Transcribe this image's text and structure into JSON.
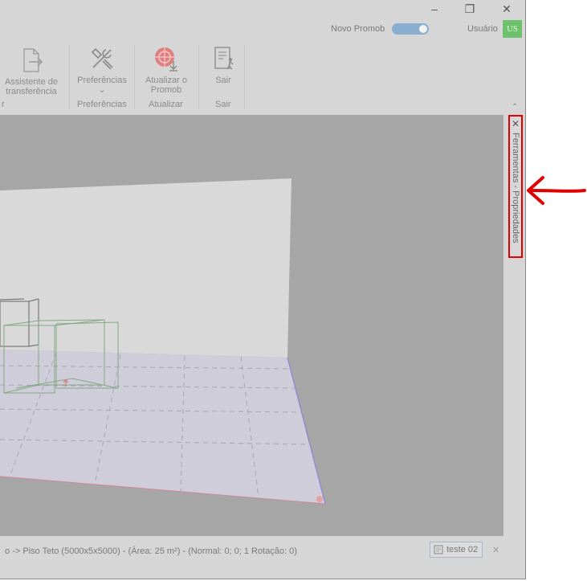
{
  "titlebar": {
    "minimize_glyph": "–",
    "restore_glyph": "❐",
    "close_glyph": "✕",
    "toggle_label": "Novo Promob",
    "user_label": "Usuário",
    "avatar_initials": "US"
  },
  "ribbon": {
    "transfer_assistant": {
      "line1": "Assistente de",
      "line2": "transferência"
    },
    "preferences": {
      "label": "Preferências",
      "chevron": "⌄",
      "group": "Preferências"
    },
    "update": {
      "line1": "Atualizar o",
      "line2": "Promob",
      "group": "Atualizar"
    },
    "exit": {
      "label": "Sair",
      "group": "Sair"
    },
    "truncated_group": "r",
    "collapse_glyph": "⌃"
  },
  "side_panel": {
    "label": "Ferramentas - Propriedades",
    "pin_glyph": "✕"
  },
  "status": {
    "text": "o -> Piso Teto (5000x5x5000) - (Área: 25 m²) - (Normal: 0; 0; 1 Rotação: 0)",
    "document_tab": "teste 02",
    "close_glyph": "✕"
  },
  "colors": {
    "annotation_red": "#e00000",
    "toggle_on": "#8aaed0",
    "avatar_green": "#6ec26e"
  }
}
